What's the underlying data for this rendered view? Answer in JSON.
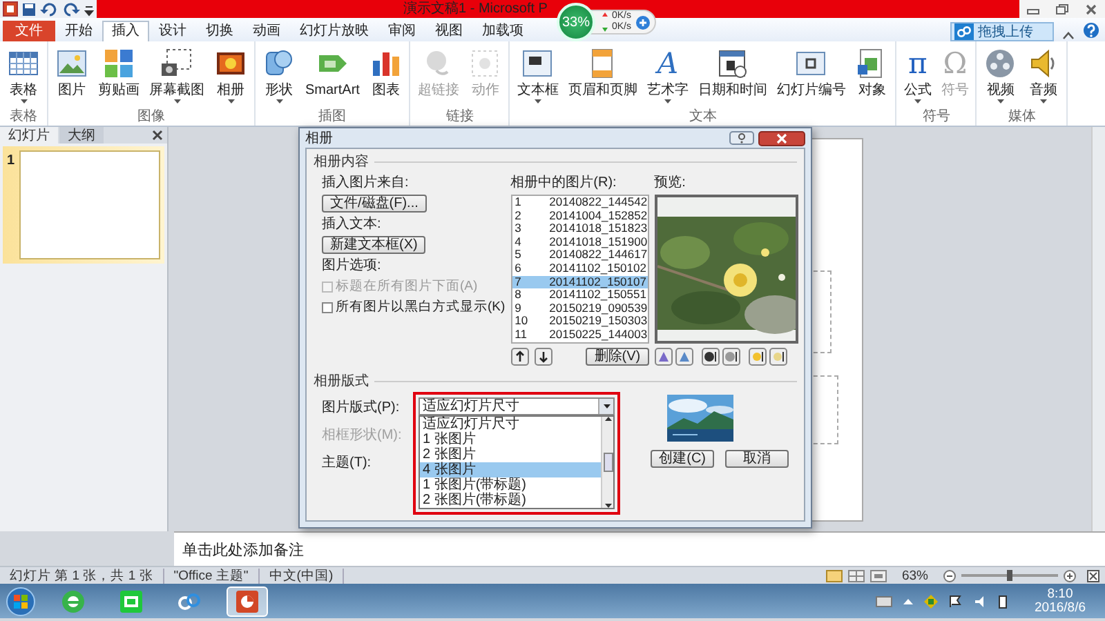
{
  "window": {
    "title": "演示文稿1 - Microsoft P"
  },
  "speed_widget": {
    "percent": "33%",
    "upload": "0K/s",
    "download": "0K/s"
  },
  "tabs": [
    {
      "label": "文件",
      "kind": "file",
      "selected": false
    },
    {
      "label": "开始",
      "kind": "tab",
      "selected": false
    },
    {
      "label": "插入",
      "kind": "tab",
      "selected": true
    },
    {
      "label": "设计",
      "kind": "tab",
      "selected": false
    },
    {
      "label": "切换",
      "kind": "tab",
      "selected": false
    },
    {
      "label": "动画",
      "kind": "tab",
      "selected": false
    },
    {
      "label": "幻灯片放映",
      "kind": "tab",
      "selected": false
    },
    {
      "label": "审阅",
      "kind": "tab",
      "selected": false
    },
    {
      "label": "视图",
      "kind": "tab",
      "selected": false
    },
    {
      "label": "加载项",
      "kind": "tab",
      "selected": false
    }
  ],
  "upload_button": "拖拽上传",
  "ribbon_groups": [
    {
      "label": "表格",
      "buttons": [
        {
          "label": "表格",
          "has_menu": true,
          "disabled": false
        }
      ]
    },
    {
      "label": "图像",
      "buttons": [
        {
          "label": "图片",
          "has_menu": false,
          "disabled": false
        },
        {
          "label": "剪贴画",
          "has_menu": false,
          "disabled": false
        },
        {
          "label": "屏幕截图",
          "has_menu": true,
          "disabled": false
        },
        {
          "label": "相册",
          "has_menu": true,
          "disabled": false
        }
      ]
    },
    {
      "label": "插图",
      "buttons": [
        {
          "label": "形状",
          "has_menu": true,
          "disabled": false
        },
        {
          "label": "SmartArt",
          "has_menu": false,
          "disabled": false
        },
        {
          "label": "图表",
          "has_menu": false,
          "disabled": false
        }
      ]
    },
    {
      "label": "链接",
      "buttons": [
        {
          "label": "超链接",
          "has_menu": false,
          "disabled": true
        },
        {
          "label": "动作",
          "has_menu": false,
          "disabled": true
        }
      ]
    },
    {
      "label": "文本",
      "buttons": [
        {
          "label": "文本框",
          "has_menu": true,
          "disabled": false
        },
        {
          "label": "页眉和页脚",
          "has_menu": false,
          "disabled": false
        },
        {
          "label": "艺术字",
          "glyph": "A",
          "has_menu": true,
          "disabled": false
        },
        {
          "label": "日期和时间",
          "has_menu": false,
          "disabled": false
        },
        {
          "label": "幻灯片编号",
          "has_menu": false,
          "disabled": false
        },
        {
          "label": "对象",
          "has_menu": false,
          "disabled": false
        }
      ]
    },
    {
      "label": "符号",
      "buttons": [
        {
          "label": "公式",
          "glyph": "π",
          "has_menu": true,
          "disabled": false
        },
        {
          "label": "符号",
          "glyph": "Ω",
          "has_menu": false,
          "disabled": true
        }
      ]
    },
    {
      "label": "媒体",
      "buttons": [
        {
          "label": "视频",
          "has_menu": true,
          "disabled": false
        },
        {
          "label": "音频",
          "has_menu": true,
          "disabled": false
        }
      ]
    }
  ],
  "left_panel": {
    "tabs": [
      {
        "label": "幻灯片",
        "selected": true
      },
      {
        "label": "大纲",
        "selected": false
      }
    ],
    "slide_number": "1"
  },
  "dialog": {
    "title": "相册",
    "content_legend": "相册内容",
    "insert_from_label": "插入图片来自:",
    "file_button": "文件/磁盘(F)...",
    "insert_text_label": "插入文本:",
    "textbox_button": "新建文本框(X)",
    "options_label": "图片选项:",
    "options": [
      {
        "label": "标题在所有图片下面(A)",
        "checked": false,
        "disabled": true
      },
      {
        "label": "所有图片以黑白方式显示(K)",
        "checked": false,
        "disabled": false
      }
    ],
    "list_label": "相册中的图片(R):",
    "pictures": [
      {
        "number": "1",
        "name": "20140822_144542",
        "selected": false
      },
      {
        "number": "2",
        "name": "20141004_152852",
        "selected": false
      },
      {
        "number": "3",
        "name": "20141018_151823",
        "selected": false
      },
      {
        "number": "4",
        "name": "20141018_151900",
        "selected": false
      },
      {
        "number": "5",
        "name": "20140822_144617",
        "selected": false
      },
      {
        "number": "6",
        "name": "20141102_150102",
        "selected": false
      },
      {
        "number": "7",
        "name": "20141102_150107",
        "selected": true
      },
      {
        "number": "8",
        "name": "20141102_150551",
        "selected": false
      },
      {
        "number": "9",
        "name": "20150219_090539",
        "selected": false
      },
      {
        "number": "10",
        "name": "20150219_150303",
        "selected": false
      },
      {
        "number": "11",
        "name": "20150225_144003",
        "selected": false
      }
    ],
    "delete_button": "删除(V)",
    "preview_label": "预览:",
    "layout_legend": "相册版式",
    "layout_label": "图片版式(P):",
    "layout_value": "适应幻灯片尺寸",
    "layout_options": [
      {
        "label": "适应幻灯片尺寸",
        "selected": false
      },
      {
        "label": "1 张图片",
        "selected": false
      },
      {
        "label": "2 张图片",
        "selected": false
      },
      {
        "label": "4 张图片",
        "selected": true
      },
      {
        "label": "1 张图片(带标题)",
        "selected": false
      },
      {
        "label": "2 张图片(带标题)",
        "selected": false
      }
    ],
    "frame_label": "相框形状(M):",
    "theme_label": "主题(T):",
    "create_button": "创建(C)",
    "cancel_button": "取消"
  },
  "notes_placeholder": "单击此处添加备注",
  "status_bar": {
    "items": [
      "幻灯片 第 1 张，共 1 张",
      "\"Office 主题\"",
      "中文(中国)"
    ],
    "zoom": "63%",
    "zoom_slider": {
      "level": 0.5
    }
  },
  "taskbar": {
    "apps": [
      {
        "active": false
      },
      {
        "active": false
      },
      {
        "active": false
      },
      {
        "active": true
      }
    ],
    "time": "8:10",
    "date": "2016/8/6"
  }
}
